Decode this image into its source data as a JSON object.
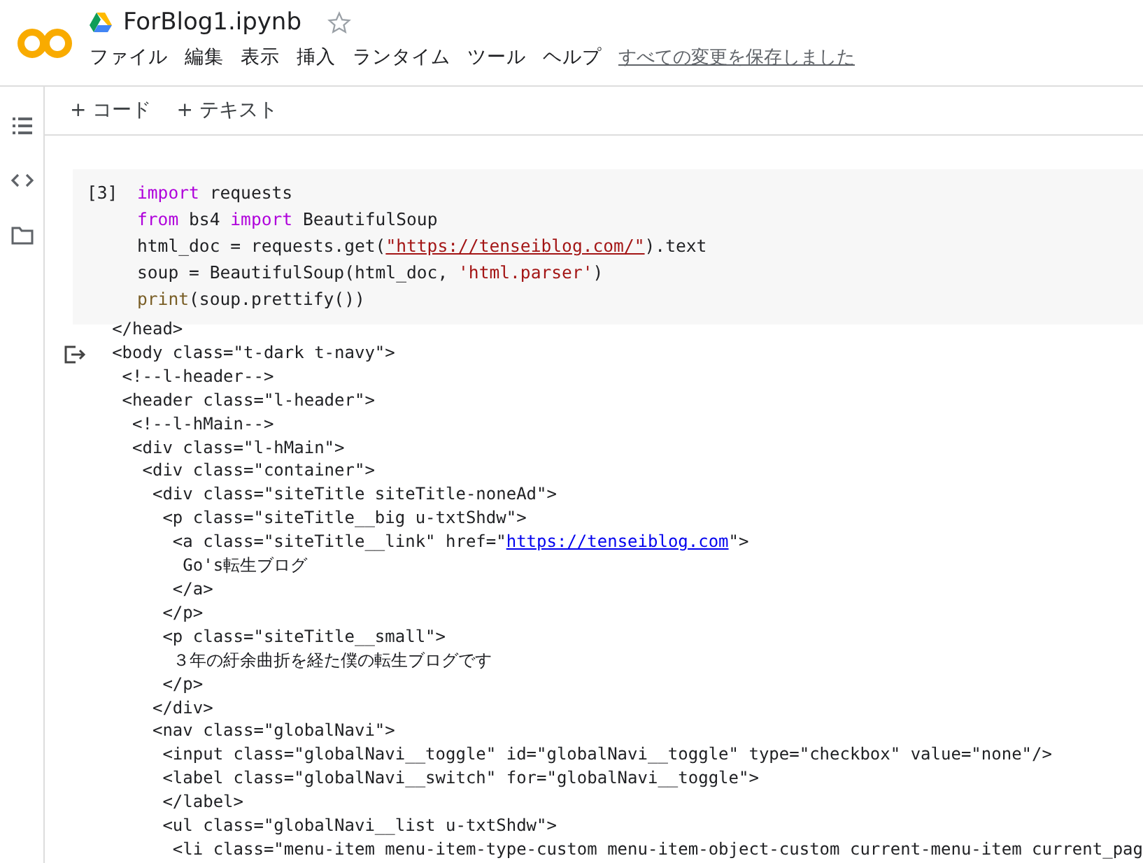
{
  "header": {
    "title": "ForBlog1.ipynb",
    "starred": false,
    "menu": [
      "ファイル",
      "編集",
      "表示",
      "挿入",
      "ランタイム",
      "ツール",
      "ヘルプ"
    ],
    "save_status": "すべての変更を保存しました"
  },
  "toolbar": [
    "+ コード",
    "+ テキスト"
  ],
  "cell": {
    "counter": "[3]",
    "lines": [
      [
        {
          "kind": "keyword",
          "text": "import"
        },
        {
          "kind": "plain",
          "text": " requests"
        }
      ],
      [
        {
          "kind": "keyword",
          "text": "from"
        },
        {
          "kind": "plain",
          "text": " bs4 "
        },
        {
          "kind": "keyword",
          "text": "import"
        },
        {
          "kind": "plain",
          "text": " BeautifulSoup"
        }
      ],
      [
        {
          "kind": "plain",
          "text": "html_doc = requests.get("
        },
        {
          "kind": "url",
          "text": "\"https://tenseiblog.com/\""
        },
        {
          "kind": "plain",
          "text": ").text"
        }
      ],
      [
        {
          "kind": "plain",
          "text": "soup = BeautifulSoup(html_doc, "
        },
        {
          "kind": "string",
          "text": "'html.parser'"
        },
        {
          "kind": "plain",
          "text": ")"
        }
      ],
      [
        {
          "kind": "builtin",
          "text": "print"
        },
        {
          "kind": "plain",
          "text": "(soup.prettify())"
        }
      ]
    ]
  },
  "output": [
    [
      {
        "kind": "text",
        "text": "</head>"
      }
    ],
    [
      {
        "kind": "text",
        "text": "<body class=\"t-dark t-navy\">"
      }
    ],
    [
      {
        "kind": "text",
        "text": " <!--l-header-->"
      }
    ],
    [
      {
        "kind": "text",
        "text": " <header class=\"l-header\">"
      }
    ],
    [
      {
        "kind": "text",
        "text": "  <!--l-hMain-->"
      }
    ],
    [
      {
        "kind": "text",
        "text": "  <div class=\"l-hMain\">"
      }
    ],
    [
      {
        "kind": "text",
        "text": "   <div class=\"container\">"
      }
    ],
    [
      {
        "kind": "text",
        "text": "    <div class=\"siteTitle siteTitle-noneAd\">"
      }
    ],
    [
      {
        "kind": "text",
        "text": "     <p class=\"siteTitle__big u-txtShdw\">"
      }
    ],
    [
      {
        "kind": "text",
        "text": "      <a class=\"siteTitle__link\" href=\""
      },
      {
        "kind": "link",
        "text": "https://tenseiblog.com"
      },
      {
        "kind": "text",
        "text": "\">"
      }
    ],
    [
      {
        "kind": "text",
        "text": "       Go's転生ブログ"
      }
    ],
    [
      {
        "kind": "text",
        "text": "      </a>"
      }
    ],
    [
      {
        "kind": "text",
        "text": "     </p>"
      }
    ],
    [
      {
        "kind": "text",
        "text": "     <p class=\"siteTitle__small\">"
      }
    ],
    [
      {
        "kind": "text",
        "text": "      ３年の紆余曲折を経た僕の転生ブログです"
      }
    ],
    [
      {
        "kind": "text",
        "text": "     </p>"
      }
    ],
    [
      {
        "kind": "text",
        "text": "    </div>"
      }
    ],
    [
      {
        "kind": "text",
        "text": "    <nav class=\"globalNavi\">"
      }
    ],
    [
      {
        "kind": "text",
        "text": "     <input class=\"globalNavi__toggle\" id=\"globalNavi__toggle\" type=\"checkbox\" value=\"none\"/>"
      }
    ],
    [
      {
        "kind": "text",
        "text": "     <label class=\"globalNavi__switch\" for=\"globalNavi__toggle\">"
      }
    ],
    [
      {
        "kind": "text",
        "text": "     </label>"
      }
    ],
    [
      {
        "kind": "text",
        "text": "     <ul class=\"globalNavi__list u-txtShdw\">"
      }
    ],
    [
      {
        "kind": "text",
        "text": "      <li class=\"menu-item menu-item-type-custom menu-item-object-custom current-menu-item current_pag"
      }
    ]
  ]
}
